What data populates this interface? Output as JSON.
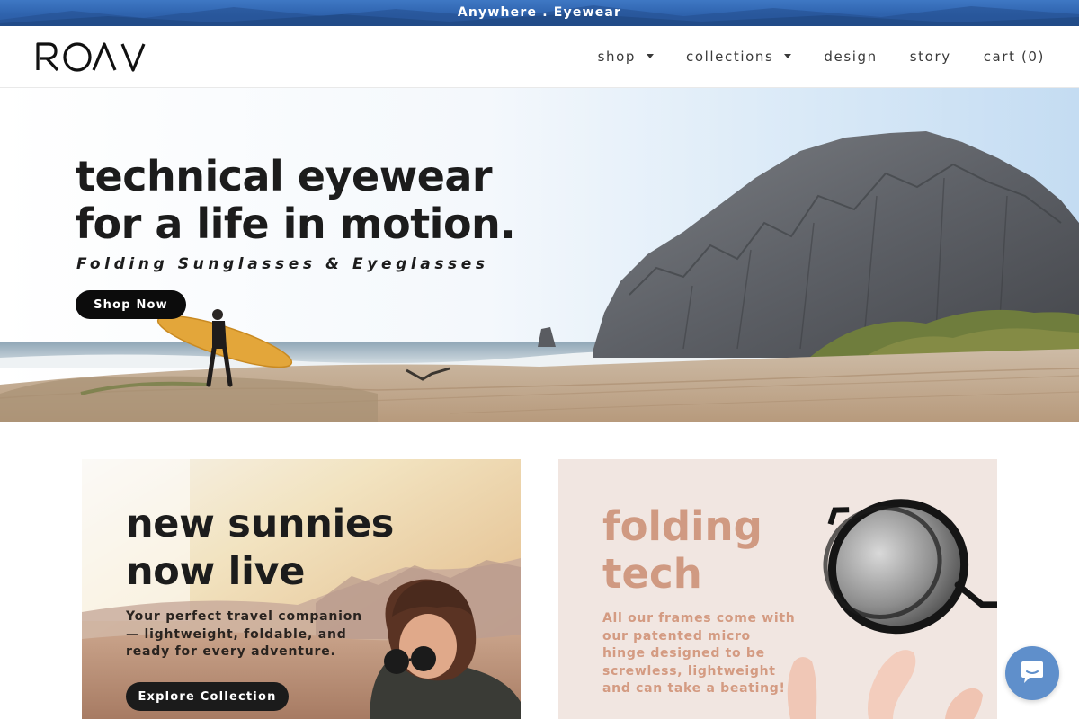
{
  "announcement": {
    "text": "Anywhere . Eyewear"
  },
  "header": {
    "logo_text": "ROAV",
    "nav": [
      {
        "label": "shop",
        "dropdown": true
      },
      {
        "label": "collections",
        "dropdown": true
      },
      {
        "label": "design",
        "dropdown": false
      },
      {
        "label": "story",
        "dropdown": false
      },
      {
        "label": "cart (0)",
        "dropdown": false
      }
    ]
  },
  "hero": {
    "title_line1": "technical eyewear",
    "title_line2": "for a life in motion.",
    "subtitle": "Folding Sunglasses & Eyeglasses",
    "button_label": "Shop Now"
  },
  "promo_left": {
    "title_line1": "new sunnies",
    "title_line2": "now live",
    "description": "Your perfect travel companion — lightweight, foldable, and ready for every adventure.",
    "button_label": "Explore Collection"
  },
  "promo_right": {
    "title_line1": "folding",
    "title_line2": "tech",
    "description": "All our frames come with our patented micro hinge designed to be screwless, lightweight and can take a beating!"
  },
  "chat_widget": {
    "icon": "chat-bubble-icon"
  },
  "colors": {
    "announcement_bg": "#2f63ae",
    "button_dark": "#0c0c0c",
    "promo_right_bg": "#f1e6e1",
    "promo_right_text": "#d09a82",
    "chat_button": "#5f8fcb"
  }
}
